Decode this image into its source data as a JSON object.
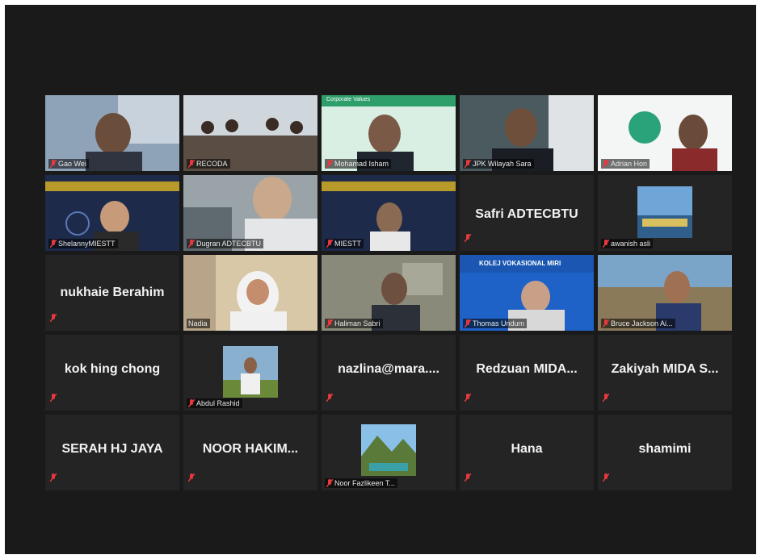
{
  "colors": {
    "background": "#1a1a1a",
    "tile": "#242424",
    "active_border": "#d6e23a",
    "mic_muted": "#e8383d"
  },
  "participants": [
    {
      "label": "Gao Wei",
      "type": "video"
    },
    {
      "label": "RECODA",
      "type": "video"
    },
    {
      "label": "Mohamad Isham",
      "type": "video",
      "slide_text": "Corporate Values"
    },
    {
      "label": "JPK Wilayah Sara",
      "type": "video"
    },
    {
      "label": "Adrian Hon",
      "type": "video"
    },
    {
      "label": "ShelannyMIESTT",
      "type": "video",
      "active_speaker": true
    },
    {
      "label": "Dugran ADTECBTU",
      "type": "video"
    },
    {
      "label": "MIESTT",
      "type": "video"
    },
    {
      "name": "Safri ADTECBTU",
      "type": "name"
    },
    {
      "label": "awanish asli",
      "type": "picture"
    },
    {
      "name": "nukhaie Berahim",
      "type": "name"
    },
    {
      "label": "Nadia",
      "type": "video"
    },
    {
      "label": "Haliman Sabri",
      "type": "video"
    },
    {
      "label": "Thomas Undum",
      "type": "video",
      "slide_text": "KOLEJ VOKASIONAL MIRI"
    },
    {
      "label": "Bruce Jackson Ai...",
      "type": "video"
    },
    {
      "name": "kok hing chong",
      "type": "name"
    },
    {
      "label": "Abdul Rashid",
      "type": "picture"
    },
    {
      "name": "nazlina@mara....",
      "type": "name"
    },
    {
      "name": "Redzuan  MIDA...",
      "type": "name"
    },
    {
      "name": "Zakiyah  MIDA S...",
      "type": "name"
    },
    {
      "name": "SERAH HJ JAYA",
      "type": "name"
    },
    {
      "name": "NOOR  HAKIM...",
      "type": "name"
    },
    {
      "label": "Noor Fazlikeen T...",
      "type": "picture"
    },
    {
      "name": "Hana",
      "type": "name"
    },
    {
      "name": "shamimi",
      "type": "name"
    }
  ]
}
